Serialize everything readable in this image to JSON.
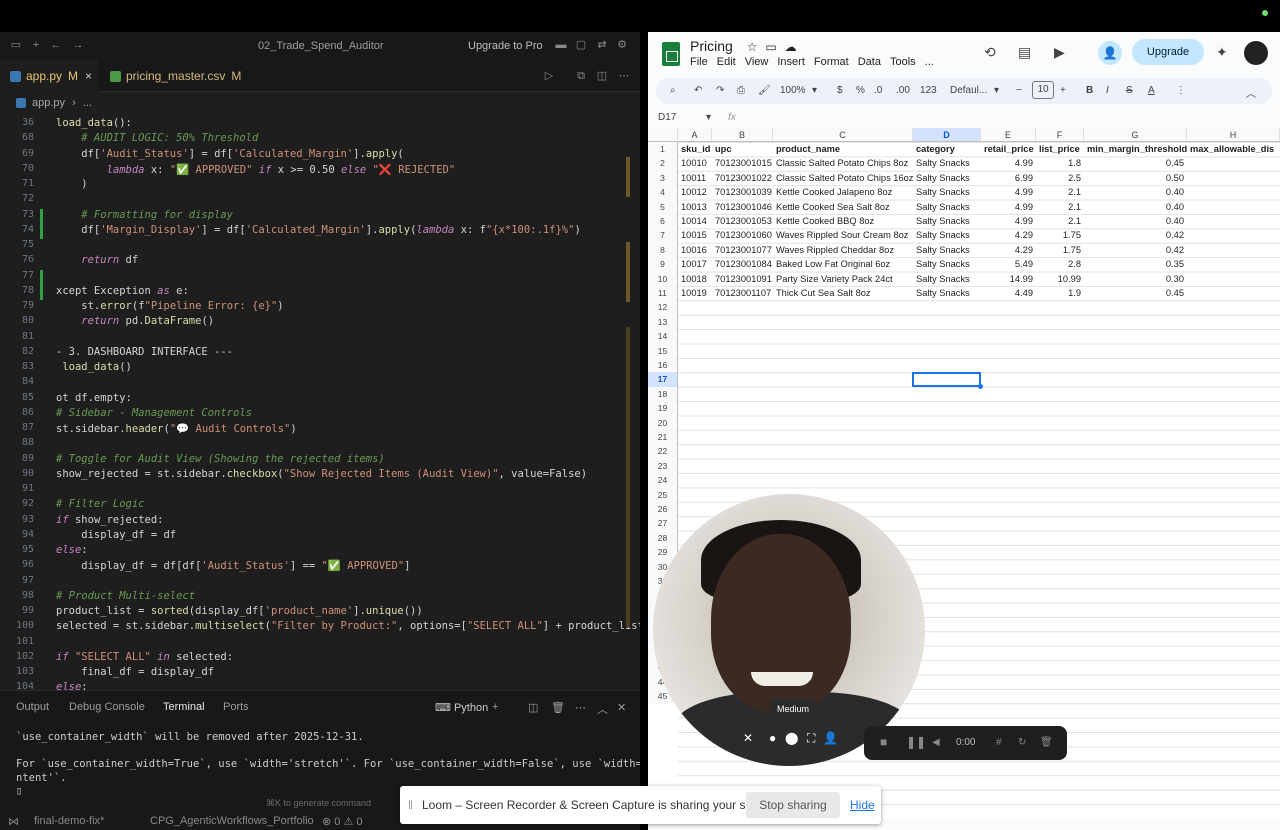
{
  "editor": {
    "window_title": "02_Trade_Spend_Auditor",
    "upgrade_label": "Upgrade to Pro",
    "tabs": [
      {
        "label": "app.py",
        "badge": "M"
      },
      {
        "label": "pricing_master.csv",
        "badge": "M"
      }
    ],
    "breadcrumb": {
      "file": "app.py",
      "rest": "..."
    },
    "code_lines": [
      {
        "n": "36",
        "text": "load_data():"
      },
      {
        "n": "68",
        "text": "    # AUDIT LOGIC: 50% Threshold"
      },
      {
        "n": "69",
        "text": "    df['Audit_Status'] = df['Calculated_Margin'].apply("
      },
      {
        "n": "70",
        "text": "        lambda x: \"✅ APPROVED\" if x >= 0.50 else \"❌ REJECTED\""
      },
      {
        "n": "71",
        "text": "    )"
      },
      {
        "n": "72",
        "text": ""
      },
      {
        "n": "73",
        "text": "    # Formatting for display"
      },
      {
        "n": "74",
        "text": "    df['Margin_Display'] = df['Calculated_Margin'].apply(lambda x: f\"{x*100:.1f}%\")"
      },
      {
        "n": "75",
        "text": ""
      },
      {
        "n": "76",
        "text": "    return df"
      },
      {
        "n": "77",
        "text": ""
      },
      {
        "n": "78",
        "text": "xcept Exception as e:"
      },
      {
        "n": "79",
        "text": "    st.error(f\"Pipeline Error: {e}\")"
      },
      {
        "n": "80",
        "text": "    return pd.DataFrame()"
      },
      {
        "n": "81",
        "text": ""
      },
      {
        "n": "82",
        "text": "- 3. DASHBOARD INTERFACE ---"
      },
      {
        "n": "83",
        "text": " load_data()"
      },
      {
        "n": "84",
        "text": ""
      },
      {
        "n": "85",
        "text": "ot df.empty:"
      },
      {
        "n": "86",
        "text": "# Sidebar - Management Controls"
      },
      {
        "n": "87",
        "text": "st.sidebar.header(\"💬 Audit Controls\")"
      },
      {
        "n": "88",
        "text": ""
      },
      {
        "n": "89",
        "text": "# Toggle for Audit View (Showing the rejected items)"
      },
      {
        "n": "90",
        "text": "show_rejected = st.sidebar.checkbox(\"Show Rejected Items (Audit View)\", value=False)"
      },
      {
        "n": "91",
        "text": ""
      },
      {
        "n": "92",
        "text": "# Filter Logic"
      },
      {
        "n": "93",
        "text": "if show_rejected:"
      },
      {
        "n": "94",
        "text": "    display_df = df"
      },
      {
        "n": "95",
        "text": "else:"
      },
      {
        "n": "96",
        "text": "    display_df = df[df['Audit_Status'] == \"✅ APPROVED\"]"
      },
      {
        "n": "97",
        "text": ""
      },
      {
        "n": "98",
        "text": "# Product Multi-select"
      },
      {
        "n": "99",
        "text": "product_list = sorted(display_df['product_name'].unique())"
      },
      {
        "n": "100",
        "text": "selected = st.sidebar.multiselect(\"Filter by Product:\", options=[\"SELECT ALL\"] + product_list, d"
      },
      {
        "n": "101",
        "text": ""
      },
      {
        "n": "102",
        "text": "if \"SELECT ALL\" in selected:"
      },
      {
        "n": "103",
        "text": "    final_df = display_df"
      },
      {
        "n": "104",
        "text": "else:"
      }
    ],
    "panel_tabs": [
      "Output",
      "Debug Console",
      "Terminal",
      "Ports"
    ],
    "panel_active": "Terminal",
    "python_label": "Python",
    "terminal_lines": [
      "`use_container_width` will be removed after 2025-12-31.",
      "",
      "For `use_container_width=True`, use `width='stretch'`. For `use_container_width=False`, use `width='co",
      "ntent'`.",
      "▯"
    ],
    "generate_hint": "⌘K to generate command",
    "status": {
      "branch": "final-demo-fix*",
      "project": "CPG_AgenticWorkflows_Portfolio",
      "problems": "⊗ 0  ⚠ 0"
    }
  },
  "sheets": {
    "doc_title": "Pricing",
    "menu": [
      "File",
      "Edit",
      "View",
      "Insert",
      "Format",
      "Data",
      "Tools",
      "..."
    ],
    "upgrade_label": "Upgrade",
    "toolbar": {
      "zoom": "100%",
      "currency": "$",
      "percent": "%",
      "dec_less": ".0",
      "dec_more": ".00",
      "format_num": "123",
      "font": "Defaul...",
      "font_size": "10"
    },
    "name_box": "D17",
    "fx": "fx",
    "columns": [
      "A",
      "B",
      "C",
      "D",
      "E",
      "F",
      "G",
      "H"
    ],
    "selected_col": "D",
    "selected_row": "17",
    "header_row": [
      "sku_id",
      "upc",
      "product_name",
      "category",
      "retail_price",
      "list_price",
      "min_margin_threshold",
      "max_allowable_dis"
    ],
    "rows": [
      [
        "10010",
        "70123001015",
        "Classic Salted Potato Chips 8oz",
        "Salty Snacks",
        "4.99",
        "1.8",
        "0.45",
        ""
      ],
      [
        "10011",
        "70123001022",
        "Classic Salted Potato Chips 16oz",
        "Salty Snacks",
        "6.99",
        "2.5",
        "0.50",
        ""
      ],
      [
        "10012",
        "70123001039",
        "Kettle Cooked Jalapeno 8oz",
        "Salty Snacks",
        "4.99",
        "2.1",
        "0.40",
        ""
      ],
      [
        "10013",
        "70123001046",
        "Kettle Cooked Sea Salt 8oz",
        "Salty Snacks",
        "4.99",
        "2.1",
        "0.40",
        ""
      ],
      [
        "10014",
        "70123001053",
        "Kettle Cooked BBQ 8oz",
        "Salty Snacks",
        "4.99",
        "2.1",
        "0.40",
        ""
      ],
      [
        "10015",
        "70123001060",
        "Waves Rippled Sour Cream 8oz",
        "Salty Snacks",
        "4.29",
        "1.75",
        "0.42",
        ""
      ],
      [
        "10016",
        "70123001077",
        "Waves Rippled Cheddar 8oz",
        "Salty Snacks",
        "4.29",
        "1.75",
        "0.42",
        ""
      ],
      [
        "10017",
        "70123001084",
        "Baked Low Fat Original 6oz",
        "Salty Snacks",
        "5.49",
        "2.8",
        "0.35",
        ""
      ],
      [
        "10018",
        "70123001091",
        "Party Size Variety Pack 24ct",
        "Salty Snacks",
        "14.99",
        "10.99",
        "0.30",
        ""
      ],
      [
        "10019",
        "70123001107",
        "Thick Cut Sea Salt 8oz",
        "Salty Snacks",
        "4.49",
        "1.9",
        "0.45",
        ""
      ]
    ],
    "row_numbers": [
      "1",
      "2",
      "3",
      "4",
      "5",
      "6",
      "7",
      "8",
      "9",
      "10",
      "11",
      "12",
      "13",
      "14",
      "15",
      "16",
      "17",
      "18",
      "19",
      "20",
      "21",
      "22",
      "23",
      "24",
      "25",
      "26",
      "27",
      "28",
      "29",
      "30",
      "31",
      "38",
      "39",
      "40",
      "41",
      "42",
      "43",
      "44",
      "45"
    ]
  },
  "loom": {
    "camera_tooltip": "Medium",
    "timer": "0:00",
    "banner_text": "Loom – Screen Recorder & Screen Capture is sharing your screen.",
    "stop_label": "Stop sharing",
    "hide_label": "Hide"
  }
}
